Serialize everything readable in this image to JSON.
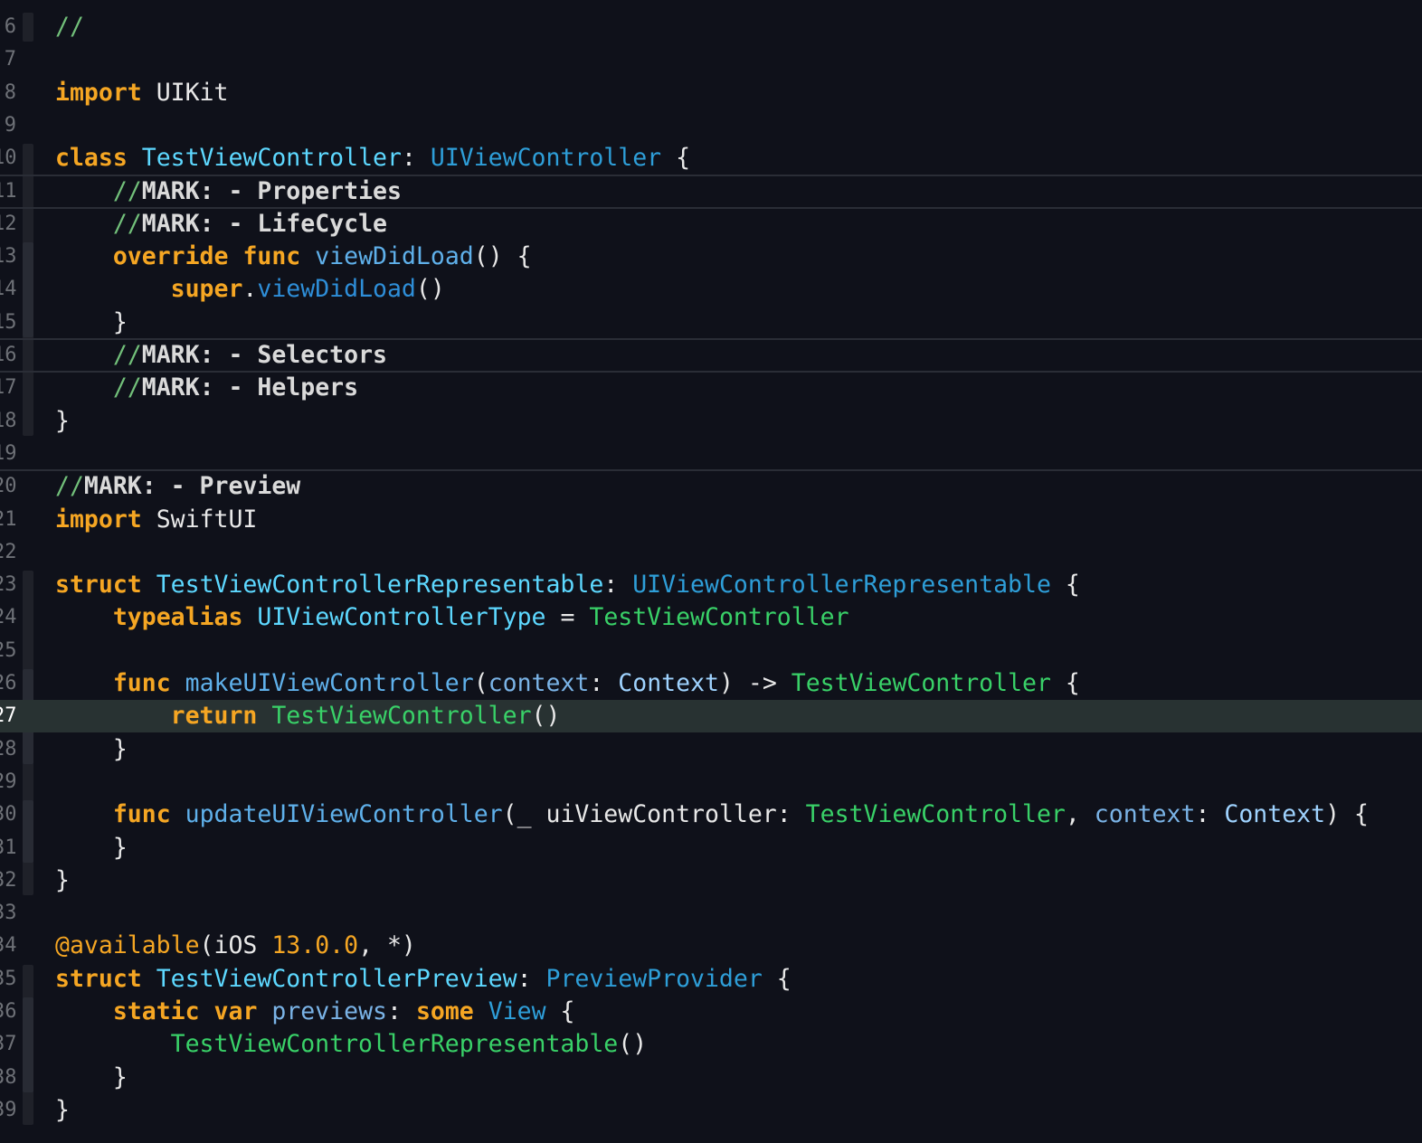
{
  "editor": {
    "language": "Swift",
    "theme_colors": {
      "background": "#0f111a",
      "current_line": "#283232",
      "keyword": "#f5a623",
      "type_declaration": "#5dd8ff",
      "type_reference": "#2e9ed8",
      "project_type": "#39d168",
      "function_declaration": "#5fb0ea",
      "comment": "#72c07a",
      "line_number": "#6e7177"
    },
    "current_line_number": "27",
    "lines": [
      {
        "number": "6",
        "tokens": [
          {
            "t": "//",
            "c": "comment-slash"
          }
        ]
      },
      {
        "number": "7",
        "tokens": []
      },
      {
        "number": "8",
        "tokens": [
          {
            "t": "import",
            "c": "kw"
          },
          {
            "t": " UIKit",
            "c": "plain"
          }
        ]
      },
      {
        "number": "9",
        "tokens": []
      },
      {
        "number": "10",
        "tokens": [
          {
            "t": "class",
            "c": "kw"
          },
          {
            "t": " ",
            "c": "plain"
          },
          {
            "t": "TestViewController",
            "c": "type-decl"
          },
          {
            "t": ": ",
            "c": "plain"
          },
          {
            "t": "UIViewController",
            "c": "type-ref"
          },
          {
            "t": " {",
            "c": "plain"
          }
        ]
      },
      {
        "number": "11",
        "tokens": [
          {
            "t": "    ",
            "c": "plain"
          },
          {
            "t": "//",
            "c": "comment-slash"
          },
          {
            "t": "MARK: - Properties",
            "c": "mark-text"
          }
        ]
      },
      {
        "number": "12",
        "tokens": [
          {
            "t": "    ",
            "c": "plain"
          },
          {
            "t": "//",
            "c": "comment-slash"
          },
          {
            "t": "MARK: - LifeCycle",
            "c": "mark-text"
          }
        ]
      },
      {
        "number": "13",
        "tokens": [
          {
            "t": "    ",
            "c": "plain"
          },
          {
            "t": "override",
            "c": "kw"
          },
          {
            "t": " ",
            "c": "plain"
          },
          {
            "t": "func",
            "c": "kw"
          },
          {
            "t": " ",
            "c": "plain"
          },
          {
            "t": "viewDidLoad",
            "c": "func-decl"
          },
          {
            "t": "() {",
            "c": "plain"
          }
        ]
      },
      {
        "number": "14",
        "tokens": [
          {
            "t": "        ",
            "c": "plain"
          },
          {
            "t": "super",
            "c": "kw"
          },
          {
            "t": ".",
            "c": "plain"
          },
          {
            "t": "viewDidLoad",
            "c": "func-call"
          },
          {
            "t": "()",
            "c": "plain"
          }
        ]
      },
      {
        "number": "15",
        "tokens": [
          {
            "t": "    }",
            "c": "plain"
          }
        ]
      },
      {
        "number": "16",
        "tokens": [
          {
            "t": "    ",
            "c": "plain"
          },
          {
            "t": "//",
            "c": "comment-slash"
          },
          {
            "t": "MARK: - Selectors",
            "c": "mark-text"
          }
        ]
      },
      {
        "number": "17",
        "tokens": [
          {
            "t": "    ",
            "c": "plain"
          },
          {
            "t": "//",
            "c": "comment-slash"
          },
          {
            "t": "MARK: - Helpers",
            "c": "mark-text"
          }
        ]
      },
      {
        "number": "18",
        "tokens": [
          {
            "t": "}",
            "c": "plain"
          }
        ]
      },
      {
        "number": "19",
        "tokens": []
      },
      {
        "number": "20",
        "tokens": [
          {
            "t": "//",
            "c": "comment-slash"
          },
          {
            "t": "MARK: - Preview",
            "c": "mark-text"
          }
        ]
      },
      {
        "number": "21",
        "tokens": [
          {
            "t": "import",
            "c": "kw"
          },
          {
            "t": " SwiftUI",
            "c": "plain"
          }
        ]
      },
      {
        "number": "22",
        "tokens": []
      },
      {
        "number": "23",
        "tokens": [
          {
            "t": "struct",
            "c": "kw"
          },
          {
            "t": " ",
            "c": "plain"
          },
          {
            "t": "TestViewControllerRepresentable",
            "c": "type-decl"
          },
          {
            "t": ": ",
            "c": "plain"
          },
          {
            "t": "UIViewControllerRepresentable",
            "c": "type-ref"
          },
          {
            "t": " {",
            "c": "plain"
          }
        ]
      },
      {
        "number": "24",
        "tokens": [
          {
            "t": "    ",
            "c": "plain"
          },
          {
            "t": "typealias",
            "c": "kw"
          },
          {
            "t": " ",
            "c": "plain"
          },
          {
            "t": "UIViewControllerType",
            "c": "type-decl"
          },
          {
            "t": " = ",
            "c": "plain"
          },
          {
            "t": "TestViewController",
            "c": "type-local"
          }
        ]
      },
      {
        "number": "25",
        "tokens": []
      },
      {
        "number": "26",
        "tokens": [
          {
            "t": "    ",
            "c": "plain"
          },
          {
            "t": "func",
            "c": "kw"
          },
          {
            "t": " ",
            "c": "plain"
          },
          {
            "t": "makeUIViewController",
            "c": "func-decl"
          },
          {
            "t": "(",
            "c": "plain"
          },
          {
            "t": "context",
            "c": "param"
          },
          {
            "t": ": ",
            "c": "plain"
          },
          {
            "t": "Context",
            "c": "ctx-type"
          },
          {
            "t": ") -> ",
            "c": "plain"
          },
          {
            "t": "TestViewController",
            "c": "type-local"
          },
          {
            "t": " {",
            "c": "plain"
          }
        ]
      },
      {
        "number": "27",
        "tokens": [
          {
            "t": "        ",
            "c": "plain"
          },
          {
            "t": "return",
            "c": "kw"
          },
          {
            "t": " ",
            "c": "plain"
          },
          {
            "t": "TestViewController",
            "c": "type-local"
          },
          {
            "t": "()",
            "c": "plain"
          }
        ]
      },
      {
        "number": "28",
        "tokens": [
          {
            "t": "    }",
            "c": "plain"
          }
        ]
      },
      {
        "number": "29",
        "tokens": []
      },
      {
        "number": "30",
        "tokens": [
          {
            "t": "    ",
            "c": "plain"
          },
          {
            "t": "func",
            "c": "kw"
          },
          {
            "t": " ",
            "c": "plain"
          },
          {
            "t": "updateUIViewController",
            "c": "func-decl"
          },
          {
            "t": "(_ uiViewController: ",
            "c": "plain"
          },
          {
            "t": "TestViewController",
            "c": "type-local"
          },
          {
            "t": ", ",
            "c": "plain"
          },
          {
            "t": "context",
            "c": "param"
          },
          {
            "t": ": ",
            "c": "plain"
          },
          {
            "t": "Context",
            "c": "ctx-type"
          },
          {
            "t": ") {",
            "c": "plain"
          }
        ]
      },
      {
        "number": "31",
        "tokens": [
          {
            "t": "    }",
            "c": "plain"
          }
        ]
      },
      {
        "number": "32",
        "tokens": [
          {
            "t": "}",
            "c": "plain"
          }
        ]
      },
      {
        "number": "33",
        "tokens": []
      },
      {
        "number": "34",
        "tokens": [
          {
            "t": "@available",
            "c": "attr"
          },
          {
            "t": "(iOS ",
            "c": "plain"
          },
          {
            "t": "13.0.0",
            "c": "num"
          },
          {
            "t": ", *)",
            "c": "plain"
          }
        ]
      },
      {
        "number": "35",
        "tokens": [
          {
            "t": "struct",
            "c": "kw"
          },
          {
            "t": " ",
            "c": "plain"
          },
          {
            "t": "TestViewControllerPreview",
            "c": "type-decl"
          },
          {
            "t": ": ",
            "c": "plain"
          },
          {
            "t": "PreviewProvider",
            "c": "type-ref"
          },
          {
            "t": " {",
            "c": "plain"
          }
        ]
      },
      {
        "number": "36",
        "tokens": [
          {
            "t": "    ",
            "c": "plain"
          },
          {
            "t": "static",
            "c": "kw"
          },
          {
            "t": " ",
            "c": "plain"
          },
          {
            "t": "var",
            "c": "kw"
          },
          {
            "t": " ",
            "c": "plain"
          },
          {
            "t": "previews",
            "c": "param"
          },
          {
            "t": ": ",
            "c": "plain"
          },
          {
            "t": "some",
            "c": "kw"
          },
          {
            "t": " ",
            "c": "plain"
          },
          {
            "t": "View",
            "c": "type-ref"
          },
          {
            "t": " {",
            "c": "plain"
          }
        ]
      },
      {
        "number": "37",
        "tokens": [
          {
            "t": "        ",
            "c": "plain"
          },
          {
            "t": "TestViewControllerRepresentable",
            "c": "type-local"
          },
          {
            "t": "()",
            "c": "plain"
          }
        ]
      },
      {
        "number": "38",
        "tokens": [
          {
            "t": "    }",
            "c": "plain"
          }
        ]
      },
      {
        "number": "39",
        "tokens": [
          {
            "t": "}",
            "c": "plain"
          }
        ]
      }
    ]
  }
}
